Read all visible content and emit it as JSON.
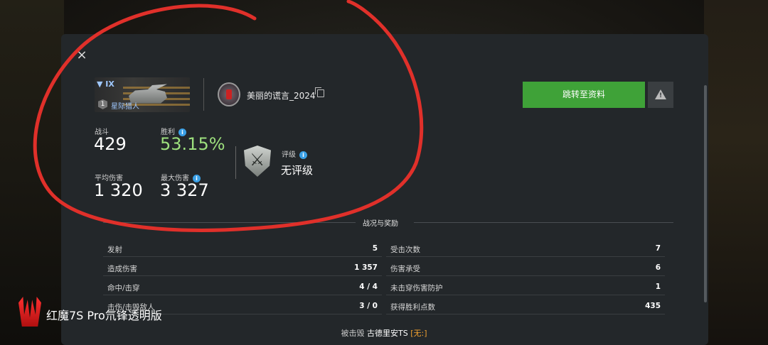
{
  "close_label": "×",
  "tank": {
    "tier": "▼ IX",
    "level": "1",
    "name": "星际猎人"
  },
  "player": {
    "name": "美丽的谎言_2024"
  },
  "buttons": {
    "go_profile": "跳转至资料",
    "report": "!"
  },
  "stats": {
    "battles_label": "战斗",
    "battles_value": "429",
    "wins_label": "胜利",
    "wins_value": "53.15%",
    "avg_damage_label": "平均伤害",
    "avg_damage_value": "1 320",
    "max_damage_label": "最大伤害",
    "max_damage_value": "3 327",
    "info_icon": "i"
  },
  "rating": {
    "label": "评级",
    "value": "无评级"
  },
  "section_title": "战况与奖励",
  "left_rows": [
    {
      "label": "发射",
      "value": "5"
    },
    {
      "label": "造成伤害",
      "value": "1 357"
    },
    {
      "label": "命中/击穿",
      "value": "4 / 4"
    },
    {
      "label": "击伤/击毁敌人",
      "value": "3 / 0"
    }
  ],
  "right_rows": [
    {
      "label": "受击次数",
      "value": "7"
    },
    {
      "label": "伤害承受",
      "value": "6"
    },
    {
      "label": "未击穿伤害防护",
      "value": "1"
    },
    {
      "label": "获得胜利点数",
      "value": "435"
    }
  ],
  "footer": {
    "prefix": "被击毁",
    "name": "古德里安TS",
    "tag": "[无:]"
  },
  "watermark": "红魔7S Pro氘锋透明版",
  "colors": {
    "accent_green": "#3fa238",
    "win_rate": "#9de07d",
    "annotation_red": "#e0302a",
    "info_blue": "#3aa0e6"
  }
}
